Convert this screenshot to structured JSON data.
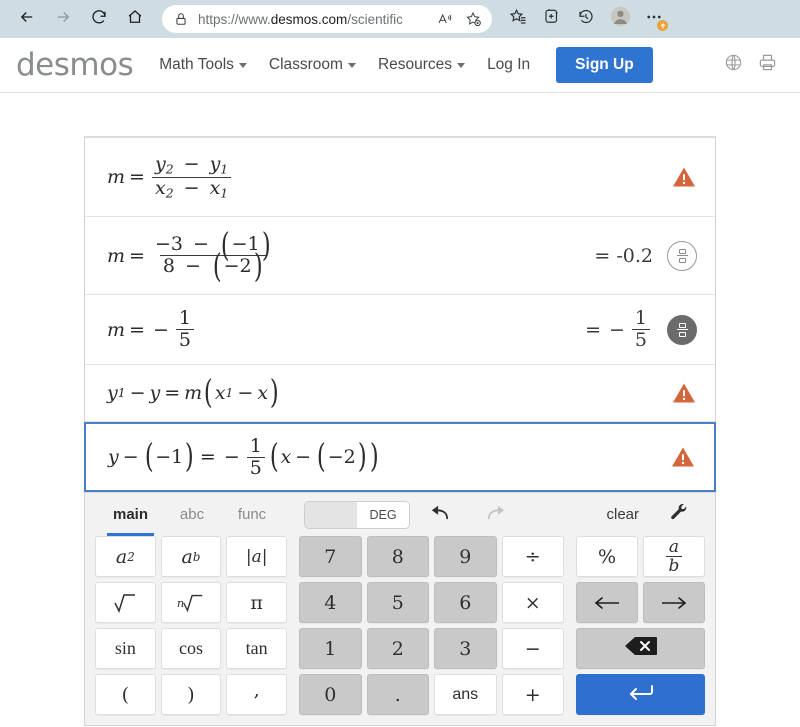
{
  "browser": {
    "back_icon": "back-arrow-icon",
    "forward_icon": "forward-arrow-icon",
    "refresh_icon": "refresh-icon",
    "home_icon": "home-icon",
    "lock_icon": "lock-icon",
    "url_scheme": "https://www.",
    "url_domain": "desmos.com",
    "url_path": "/scientific",
    "url_full": "https://www.desmos.com/scientific",
    "read_aloud_icon": "read-aloud-icon",
    "add_favorite_icon": "add-favorite-star-icon",
    "favorites_icon": "favorites-list-icon",
    "collections_icon": "collections-icon",
    "history_icon": "history-icon",
    "profile_icon": "profile-avatar-icon",
    "settings_icon": "more-settings-ellipsis-icon"
  },
  "header": {
    "logo": "desmos",
    "nav": [
      {
        "label": "Math Tools",
        "has_caret": true
      },
      {
        "label": "Classroom",
        "has_caret": true
      },
      {
        "label": "Resources",
        "has_caret": true
      },
      {
        "label": "Log In",
        "has_caret": false
      }
    ],
    "signup_label": "Sign Up",
    "language_icon": "globe-language-icon",
    "print_icon": "printer-icon",
    "accent_color": "#2f74d0"
  },
  "expressions": [
    {
      "id": "row-1",
      "lhs": "m",
      "expression": "m = (y_2 - y_1) / (x_2 - x_1)",
      "result": "",
      "status": "warning",
      "status_icon": "warning-triangle-icon",
      "focused": false
    },
    {
      "id": "row-2",
      "lhs": "m",
      "expression": "m = (-3 - (-1)) / (8 - (-2))",
      "result": "= -0.2",
      "status": "fraction-toggle-inactive",
      "status_icon": "fraction-toggle-icon",
      "focused": false
    },
    {
      "id": "row-3",
      "lhs": "m",
      "expression": "m = -1/5",
      "result": "= -1/5",
      "status": "fraction-toggle-active",
      "status_icon": "fraction-toggle-icon",
      "focused": false
    },
    {
      "id": "row-4",
      "lhs": "y_1",
      "expression": "y_1 - y = m(x_1 - x)",
      "result": "",
      "status": "warning",
      "status_icon": "warning-triangle-icon",
      "focused": false
    },
    {
      "id": "row-5",
      "lhs": "y",
      "expression": "y - (-1) = -1/5 (x - (-2))",
      "result": "",
      "status": "warning",
      "status_icon": "warning-triangle-icon",
      "focused": true
    }
  ],
  "keypad": {
    "tabs": [
      {
        "label": "main",
        "active": true
      },
      {
        "label": "abc",
        "active": false
      },
      {
        "label": "func",
        "active": false
      }
    ],
    "angle_toggle": {
      "off_label": "",
      "on_label": "DEG",
      "selected": "DEG"
    },
    "undo_icon": "undo-arrow-icon",
    "redo_icon": "redo-arrow-icon",
    "clear_label": "clear",
    "wrench_icon": "wrench-settings-icon",
    "left_keys": [
      {
        "label": "a2",
        "name": "key-a-squared",
        "style": "white"
      },
      {
        "label": "ab",
        "name": "key-a-power-b",
        "style": "white"
      },
      {
        "label": "|a|",
        "name": "key-absolute-value",
        "style": "white"
      },
      {
        "label": "sqrt",
        "name": "key-square-root",
        "style": "white"
      },
      {
        "label": "nthroot",
        "name": "key-nth-root",
        "style": "white"
      },
      {
        "label": "π",
        "name": "key-pi",
        "style": "white"
      },
      {
        "label": "sin",
        "name": "key-sin",
        "style": "white"
      },
      {
        "label": "cos",
        "name": "key-cos",
        "style": "white"
      },
      {
        "label": "tan",
        "name": "key-tan",
        "style": "white"
      },
      {
        "label": "(",
        "name": "key-left-paren",
        "style": "white"
      },
      {
        "label": ")",
        "name": "key-right-paren",
        "style": "white"
      },
      {
        "label": ",",
        "name": "key-comma",
        "style": "white"
      }
    ],
    "mid_keys": [
      {
        "label": "7",
        "name": "key-7",
        "style": "gray"
      },
      {
        "label": "8",
        "name": "key-8",
        "style": "gray"
      },
      {
        "label": "9",
        "name": "key-9",
        "style": "gray"
      },
      {
        "label": "÷",
        "name": "key-divide",
        "style": "white"
      },
      {
        "label": "4",
        "name": "key-4",
        "style": "gray"
      },
      {
        "label": "5",
        "name": "key-5",
        "style": "gray"
      },
      {
        "label": "6",
        "name": "key-6",
        "style": "gray"
      },
      {
        "label": "×",
        "name": "key-multiply",
        "style": "white"
      },
      {
        "label": "1",
        "name": "key-1",
        "style": "gray"
      },
      {
        "label": "2",
        "name": "key-2",
        "style": "gray"
      },
      {
        "label": "3",
        "name": "key-3",
        "style": "gray"
      },
      {
        "label": "−",
        "name": "key-minus",
        "style": "white"
      },
      {
        "label": "0",
        "name": "key-0",
        "style": "gray"
      },
      {
        "label": ".",
        "name": "key-decimal-point",
        "style": "gray"
      },
      {
        "label": "ans",
        "name": "key-ans",
        "style": "white"
      },
      {
        "label": "+",
        "name": "key-plus",
        "style": "white"
      }
    ],
    "right_keys": {
      "percent": "%",
      "fraction": "a/b",
      "left_arrow": "←",
      "right_arrow": "→",
      "backspace": "backspace-icon",
      "enter": "enter-return-icon"
    },
    "enter_color": "#2f6fd0"
  }
}
